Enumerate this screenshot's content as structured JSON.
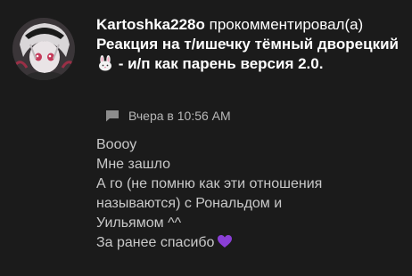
{
  "notification": {
    "username": "Kartoshka228o",
    "action": "прокомментировал(а)",
    "post_title_part1": "Реакция на т/ишечку тёмный дворецкий",
    "post_title_part2": " - и/п как парень версия 2.0.",
    "timestamp": "Вчера в 10:56 AM",
    "icons": {
      "avatar": "user-avatar",
      "title_emoji": "rabbit-face-icon",
      "meta": "comment-icon",
      "end_emoji": "purple-heart-icon"
    }
  },
  "comment": {
    "lines": [
      "Воооу",
      "Мне зашло",
      "А го (не помню как эти отношения",
      "называются) с Рональдом и",
      "Уильямом ^^",
      "За ранее спасибо"
    ]
  },
  "colors": {
    "background": "#1b1b1b",
    "title_text": "#ffffff",
    "body_text": "#c9c9c9",
    "meta_text": "#b8b8b8",
    "heart": "#8a3fd6"
  }
}
